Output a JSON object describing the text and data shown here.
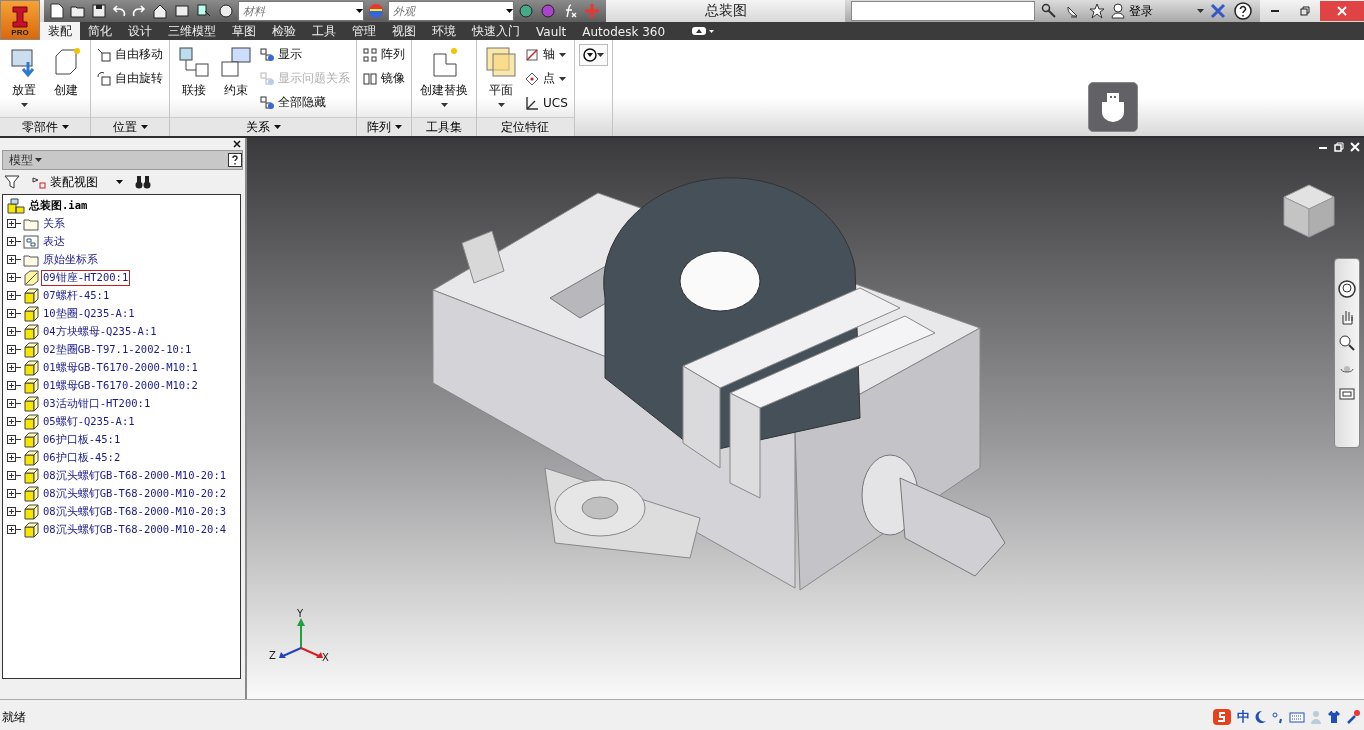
{
  "app_button": {
    "label": "PRO"
  },
  "quick_access": {
    "material": {
      "value": "材料"
    },
    "appearance": {
      "value": "外观"
    }
  },
  "title": "总装图",
  "sign_in": "登录",
  "tabs": [
    {
      "label": "装配",
      "selected": true
    },
    {
      "label": "简化",
      "selected": false
    },
    {
      "label": "设计",
      "selected": false
    },
    {
      "label": "三维模型",
      "selected": false
    },
    {
      "label": "草图",
      "selected": false
    },
    {
      "label": "检验",
      "selected": false
    },
    {
      "label": "工具",
      "selected": false
    },
    {
      "label": "管理",
      "selected": false
    },
    {
      "label": "视图",
      "selected": false
    },
    {
      "label": "环境",
      "selected": false
    },
    {
      "label": "快速入门",
      "selected": false
    },
    {
      "label": "Vault",
      "selected": false
    },
    {
      "label": "Autodesk 360",
      "selected": false
    }
  ],
  "ribbon": [
    {
      "name": "零部件",
      "menu": true,
      "columns": [
        [
          {
            "kind": "large",
            "label": "放置",
            "caret": true,
            "disabled": false
          }
        ],
        [
          {
            "kind": "large",
            "label": "创建",
            "caret": false,
            "disabled": false
          }
        ]
      ]
    },
    {
      "name": "位置",
      "menu": true,
      "columns": [
        [
          {
            "kind": "small",
            "label": "自由移动",
            "caret": false,
            "disabled": false
          },
          {
            "kind": "small",
            "label": "自由旋转",
            "caret": false,
            "disabled": false
          }
        ]
      ]
    },
    {
      "name": "关系",
      "menu": true,
      "columns": [
        [
          {
            "kind": "large",
            "label": "联接",
            "caret": false,
            "disabled": false
          }
        ],
        [
          {
            "kind": "large",
            "label": "约束",
            "caret": false,
            "disabled": false
          }
        ],
        [
          {
            "kind": "small",
            "label": "显示",
            "caret": false,
            "disabled": false
          },
          {
            "kind": "small",
            "label": "显示问题关系",
            "caret": false,
            "disabled": true
          },
          {
            "kind": "small",
            "label": "全部隐藏",
            "caret": false,
            "disabled": false
          }
        ]
      ]
    },
    {
      "name": "阵列",
      "menu": true,
      "columns": [
        [
          {
            "kind": "small",
            "label": "阵列",
            "caret": false,
            "disabled": false
          },
          {
            "kind": "small",
            "label": "镜像",
            "caret": false,
            "disabled": false
          }
        ]
      ]
    },
    {
      "name": "工具集",
      "menu": false,
      "columns": [
        [
          {
            "kind": "large",
            "label": "创建替换",
            "caret": true,
            "disabled": false
          }
        ]
      ]
    },
    {
      "name": "定位特征",
      "menu": false,
      "columns": [
        [
          {
            "kind": "large",
            "label": "平面",
            "caret": true,
            "disabled": false
          }
        ],
        [
          {
            "kind": "small",
            "label": "轴",
            "caret": true,
            "disabled": false
          },
          {
            "kind": "small",
            "label": "点",
            "caret": true,
            "disabled": false
          },
          {
            "kind": "small",
            "label": "UCS",
            "caret": false,
            "disabled": false
          }
        ]
      ]
    }
  ],
  "browser": {
    "header": "模型",
    "view": "装配视图",
    "root": "总装图.iam",
    "items": [
      {
        "kind": "folder",
        "label": "关系",
        "selected": false
      },
      {
        "kind": "representation",
        "label": "表达",
        "selected": false
      },
      {
        "kind": "folder",
        "label": "原始坐标系",
        "selected": false
      },
      {
        "kind": "grounded",
        "label": "09钳座-HT200:1",
        "selected": true
      },
      {
        "kind": "part",
        "label": "07螺杆-45:1",
        "selected": false
      },
      {
        "kind": "part",
        "label": "10垫圈-Q235-A:1",
        "selected": false
      },
      {
        "kind": "part",
        "label": "04方块螺母-Q235-A:1",
        "selected": false
      },
      {
        "kind": "part",
        "label": "02垫圈GB-T97.1-2002-10:1",
        "selected": false
      },
      {
        "kind": "part",
        "label": "01螺母GB-T6170-2000-M10:1",
        "selected": false
      },
      {
        "kind": "part",
        "label": "01螺母GB-T6170-2000-M10:2",
        "selected": false
      },
      {
        "kind": "part",
        "label": "03活动钳口-HT200:1",
        "selected": false
      },
      {
        "kind": "part",
        "label": "05螺钉-Q235-A:1",
        "selected": false
      },
      {
        "kind": "part",
        "label": "06护口板-45:1",
        "selected": false
      },
      {
        "kind": "part",
        "label": "06护口板-45:2",
        "selected": false
      },
      {
        "kind": "part",
        "label": "08沉头螺钉GB-T68-2000-M10-20:1",
        "selected": false
      },
      {
        "kind": "part",
        "label": "08沉头螺钉GB-T68-2000-M10-20:2",
        "selected": false
      },
      {
        "kind": "part",
        "label": "08沉头螺钉GB-T68-2000-M10-20:3",
        "selected": false
      },
      {
        "kind": "part",
        "label": "08沉头螺钉GB-T68-2000-M10-20:4",
        "selected": false
      }
    ]
  },
  "viewport": {
    "axes": [
      {
        "kind": "y",
        "label": "Y"
      },
      {
        "kind": "z",
        "label": "Z"
      },
      {
        "kind": "x",
        "label": "X"
      }
    ]
  },
  "status": {
    "text": "就绪",
    "ime": "中"
  }
}
